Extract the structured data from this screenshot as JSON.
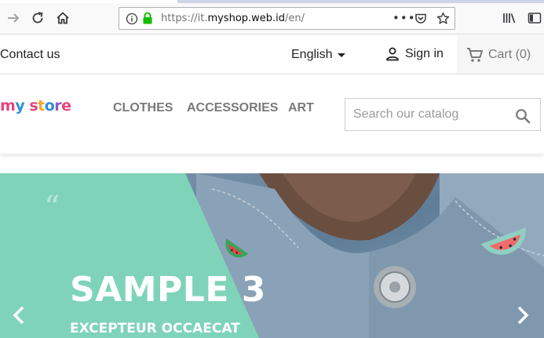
{
  "browser": {
    "url_prefix": "https://it.",
    "url_domain": "myshop.web.id",
    "url_suffix": "/en/",
    "menu_dots": "•••"
  },
  "header": {
    "contact_label": "Contact us",
    "language_label": "English",
    "signin_label": "Sign in",
    "cart_label": "Cart (0)"
  },
  "logo": {
    "letters": [
      "m",
      "y",
      " ",
      "s",
      "t",
      "o",
      "r",
      "e"
    ],
    "colors": [
      "#e4447c",
      "#2f8fd7",
      "#ffffff",
      "#e4447c",
      "#f2a633",
      "#2f8fd7",
      "#8b5bc9",
      "#e4447c"
    ]
  },
  "nav": {
    "items": [
      "CLOTHES",
      "ACCESSORIES",
      "ART"
    ]
  },
  "search": {
    "placeholder": "Search our catalog"
  },
  "slider": {
    "quote": "“",
    "title": "SAMPLE 3",
    "subtitle": "EXCEPTEUR OCCAECAT",
    "accent_color": "#7fd3b9"
  }
}
